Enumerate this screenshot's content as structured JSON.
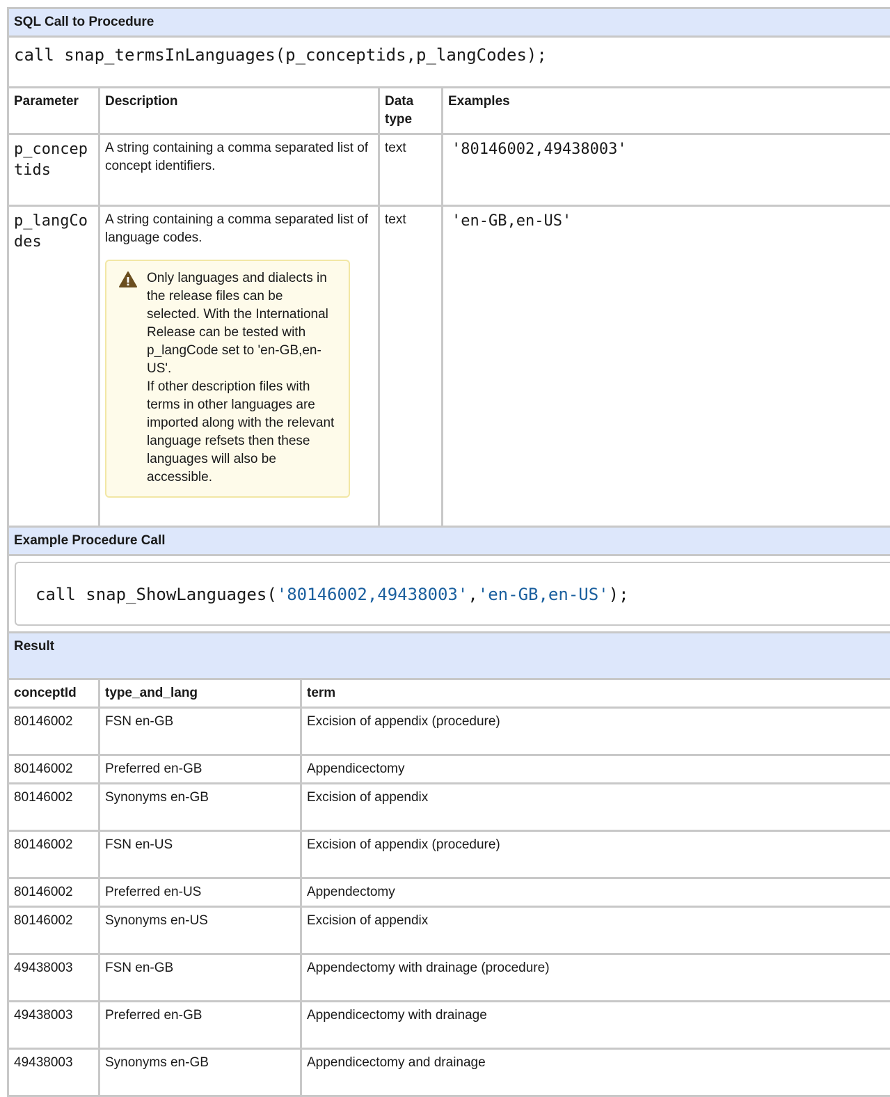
{
  "sql_call_section": {
    "heading": "SQL Call to Procedure",
    "call_text": "call snap_termsInLanguages(p_conceptids,p_langCodes);"
  },
  "parameters_table": {
    "headers": {
      "parameter": "Parameter",
      "description": "Description",
      "data_type": "Data type",
      "examples": "Examples"
    },
    "rows": [
      {
        "parameter": "p_conceptids",
        "description": "A string containing a comma separated list of concept identifiers.",
        "data_type": "text",
        "example": "'80146002,49438003'"
      },
      {
        "parameter": "p_langCodes",
        "description": "A string containing a comma separated list of language codes.",
        "data_type": "text",
        "example": "'en-GB,en-US'",
        "warning": {
          "icon": "warning-triangle-icon",
          "line1": "Only languages and dialects in the release files can be selected. With the International Release can be tested with p_langCode set to 'en-GB,en-US'.",
          "line2": "If other description files with terms in other languages are imported along with the relevant language refsets then these languages will also be accessible."
        }
      }
    ]
  },
  "example_section": {
    "heading": "Example Procedure Call",
    "code_prefix": "call snap_ShowLanguages(",
    "arg1": "'80146002,49438003'",
    "comma": ",",
    "arg2": "'en-GB,en-US'",
    "code_suffix": ");"
  },
  "result_section": {
    "heading": "Result",
    "headers": {
      "concept_id": "conceptId",
      "type_and_lang": "type_and_lang",
      "term": "term"
    },
    "rows": [
      {
        "concept_id": "80146002",
        "type_and_lang": "FSN en-GB",
        "term": "Excision of appendix (procedure)"
      },
      {
        "concept_id": "80146002",
        "type_and_lang": "Preferred en-GB",
        "term": "Appendicectomy"
      },
      {
        "concept_id": "80146002",
        "type_and_lang": "Synonyms en-GB",
        "term": "Excision of appendix"
      },
      {
        "concept_id": "80146002",
        "type_and_lang": "FSN en-US",
        "term": "Excision of appendix (procedure)"
      },
      {
        "concept_id": "80146002",
        "type_and_lang": "Preferred en-US",
        "term": "Appendectomy"
      },
      {
        "concept_id": "80146002",
        "type_and_lang": "Synonyms en-US",
        "term": "Excision of appendix"
      },
      {
        "concept_id": "49438003",
        "type_and_lang": "FSN en-GB",
        "term": "Appendectomy with drainage (procedure)"
      },
      {
        "concept_id": "49438003",
        "type_and_lang": "Preferred en-GB",
        "term": "Appendicectomy with drainage"
      },
      {
        "concept_id": "49438003",
        "type_and_lang": "Synonyms en-GB",
        "term": "Appendicectomy and drainage"
      }
    ]
  },
  "colors": {
    "header_background": "#dde7fb",
    "border": "#c8c8c8",
    "warning_background": "#fefbea",
    "warning_border": "#f2e7a5",
    "warning_icon": "#6b4e1f",
    "string_literal": "#1a5f9e"
  }
}
